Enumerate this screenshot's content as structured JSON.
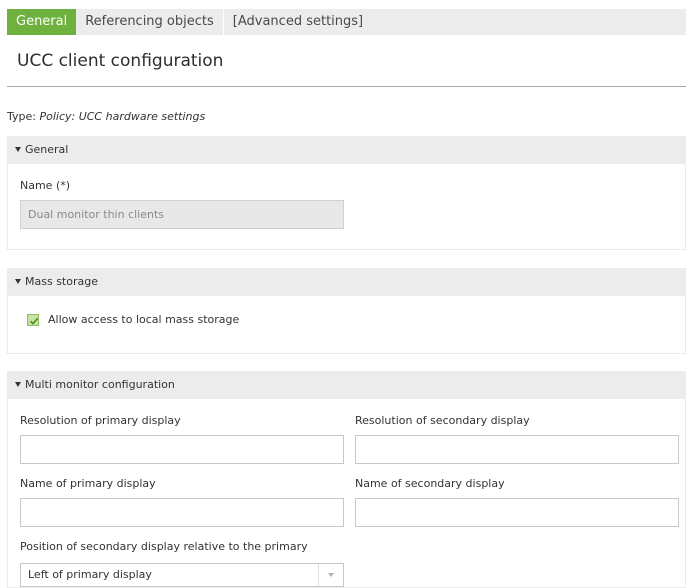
{
  "tabs": [
    {
      "label": "General",
      "active": true
    },
    {
      "label": "Referencing objects",
      "active": false
    },
    {
      "label": "[Advanced settings]",
      "active": false
    }
  ],
  "page_title": "UCC client configuration",
  "type_line": {
    "prefix": "Type: ",
    "value": "Policy: UCC hardware settings"
  },
  "sections": {
    "general": {
      "header": "General",
      "name_label": "Name (*)",
      "name_value": "Dual monitor thin clients"
    },
    "mass_storage": {
      "header": "Mass storage",
      "checkbox_label": "Allow access to local mass storage",
      "checked": true
    },
    "multi_monitor": {
      "header": "Multi monitor configuration",
      "res_primary_label": "Resolution of primary display",
      "res_primary_value": "",
      "res_secondary_label": "Resolution of secondary display",
      "res_secondary_value": "",
      "name_primary_label": "Name of primary display",
      "name_primary_value": "",
      "name_secondary_label": "Name of secondary display",
      "name_secondary_value": "",
      "position_label": "Position of secondary display relative to the primary",
      "position_value": "Left of primary display"
    }
  },
  "colors": {
    "accent": "#6fb13f",
    "header_bg": "#ececec",
    "disabled_bg": "#e8e8e8"
  }
}
